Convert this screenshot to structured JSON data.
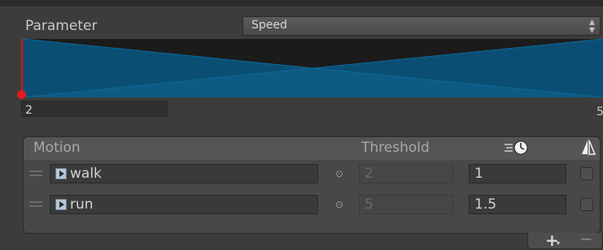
{
  "parameter": {
    "label": "Parameter",
    "selected": "Speed"
  },
  "blend": {
    "min_value": "2",
    "max_value": "5",
    "colors": {
      "graph_background": "#1b1b1b",
      "graph_fill": "#0a4f73",
      "marker": "#e11010"
    }
  },
  "motion_list": {
    "header": {
      "motion": "Motion",
      "threshold": "Threshold"
    },
    "rows": [
      {
        "motion": "walk",
        "threshold": "2",
        "speed": "1"
      },
      {
        "motion": "run",
        "threshold": "5",
        "speed": "1.5"
      }
    ]
  },
  "footer": {
    "add_label": "+",
    "remove_label": "−"
  }
}
